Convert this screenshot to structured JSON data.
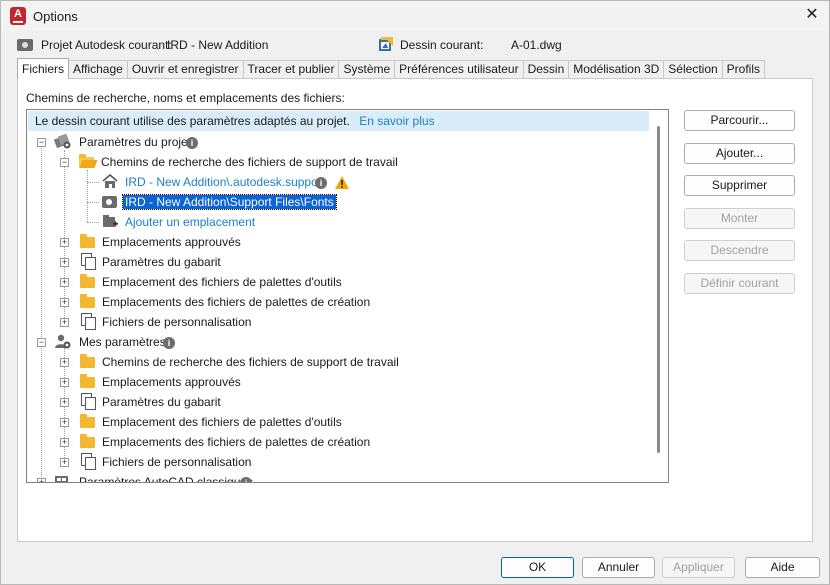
{
  "window": {
    "title": "Options",
    "app_icon_letter": "A",
    "close_glyph": "✕"
  },
  "info": {
    "profile_label": "Projet Autodesk courant:",
    "profile_value": "IRD - New Addition",
    "drawing_label": "Dessin courant:",
    "drawing_value": "A-01.dwg"
  },
  "tabs": [
    {
      "label": "Fichiers",
      "active": true
    },
    {
      "label": "Affichage"
    },
    {
      "label": "Ouvrir et enregistrer"
    },
    {
      "label": "Tracer et publier"
    },
    {
      "label": "Système"
    },
    {
      "label": "Préférences utilisateur"
    },
    {
      "label": "Dessin"
    },
    {
      "label": "Modélisation 3D"
    },
    {
      "label": "Sélection"
    },
    {
      "label": "Profils"
    }
  ],
  "section_label": "Chemins de recherche, noms et emplacements des fichiers:",
  "notice": {
    "text": "Le dessin courant utilise des paramètres adaptés au projet.",
    "link": "En savoir plus"
  },
  "tree": {
    "project_settings": "Paramètres du projet",
    "support_paths": "Chemins de recherche des fichiers de support de travail",
    "path1": "IRD - New Addition\\.autodesk.support",
    "path2": "IRD - New Addition\\Support Files\\Fonts",
    "add_location": "Ajouter un emplacement",
    "trusted": "Emplacements approuvés",
    "template": "Paramètres du gabarit",
    "tool_palettes": "Emplacement des fichiers de palettes d'outils",
    "authoring_palettes": "Emplacements des fichiers de palettes de création",
    "customization": "Fichiers de personnalisation",
    "my_settings": "Mes paramètres",
    "my_support_paths": "Chemins de recherche des fichiers de support de travail",
    "my_trusted": "Emplacements approuvés",
    "my_template": "Paramètres du gabarit",
    "my_tool_palettes": "Emplacement des fichiers de palettes d'outils",
    "my_authoring_palettes": "Emplacements des fichiers de palettes de création",
    "my_customization": "Fichiers de personnalisation",
    "classic": "Paramètres AutoCAD classiques"
  },
  "side_buttons": {
    "browse": "Parcourir...",
    "add": "Ajouter...",
    "remove": "Supprimer",
    "move_up": "Monter",
    "move_down": "Descendre",
    "set_current": "Définir courant"
  },
  "footer": {
    "ok": "OK",
    "cancel": "Annuler",
    "apply": "Appliquer",
    "help": "Aide"
  },
  "colors": {
    "selection": "#0a64d6",
    "link": "#1b80c5",
    "notice_bg": "#d9ecfa",
    "folder": "#f2b830",
    "warning": "#f2a900"
  }
}
